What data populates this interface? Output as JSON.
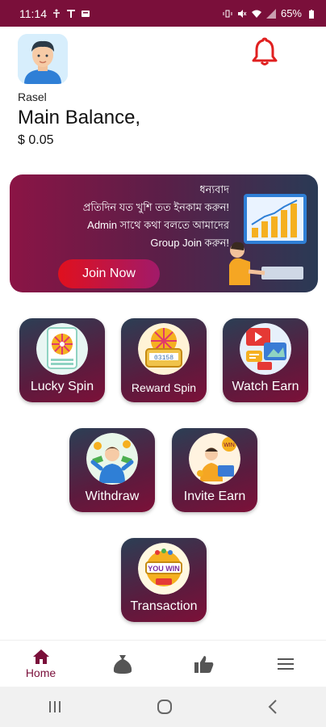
{
  "status_bar": {
    "time": "11:14",
    "battery": "65%",
    "bg_color": "#7a0f3a",
    "icons_left": [
      "accessibility-icon",
      "t-icon",
      "message-icon"
    ],
    "icons_right": [
      "vibrate-icon",
      "volume-off-icon",
      "wifi-icon",
      "signal-icon",
      "battery-icon"
    ]
  },
  "header": {
    "user_name": "Rasel",
    "balance_title": "Main Balance,",
    "balance_value": "$ 0.05",
    "notification_icon": "bell-icon",
    "accent_color": "#e02020"
  },
  "banner": {
    "lines": [
      "ধন্যবাদ",
      "প্রতিদিন যত খুশি তত ইনকাম করুন!",
      "Admin সাথে কথা বলতে আমাদের",
      "Group Join করুন!"
    ],
    "button_label": "Join Now"
  },
  "tiles": [
    {
      "label": "Lucky Spin",
      "icon": "lucky-spin-icon"
    },
    {
      "label": "Reward Spin",
      "icon": "reward-spin-icon"
    },
    {
      "label": "Watch Earn",
      "icon": "watch-earn-icon"
    },
    {
      "label": "Withdraw",
      "icon": "withdraw-icon"
    },
    {
      "label": "Invite Earn",
      "icon": "invite-earn-icon"
    },
    {
      "label": "Transaction",
      "icon": "transaction-icon",
      "badge_text": "YOU WIN"
    }
  ],
  "reward_code": "03158",
  "bottom_nav": {
    "items": [
      {
        "label": "Home",
        "icon": "home-icon",
        "active": true
      },
      {
        "label": "",
        "icon": "money-bag-icon"
      },
      {
        "label": "",
        "icon": "thumbs-up-icon"
      },
      {
        "label": "",
        "icon": "menu-icon"
      }
    ],
    "active_color": "#7a0f3a"
  },
  "system_nav": {
    "icons": [
      "recent-apps-icon",
      "home-circle-icon",
      "back-icon"
    ]
  }
}
